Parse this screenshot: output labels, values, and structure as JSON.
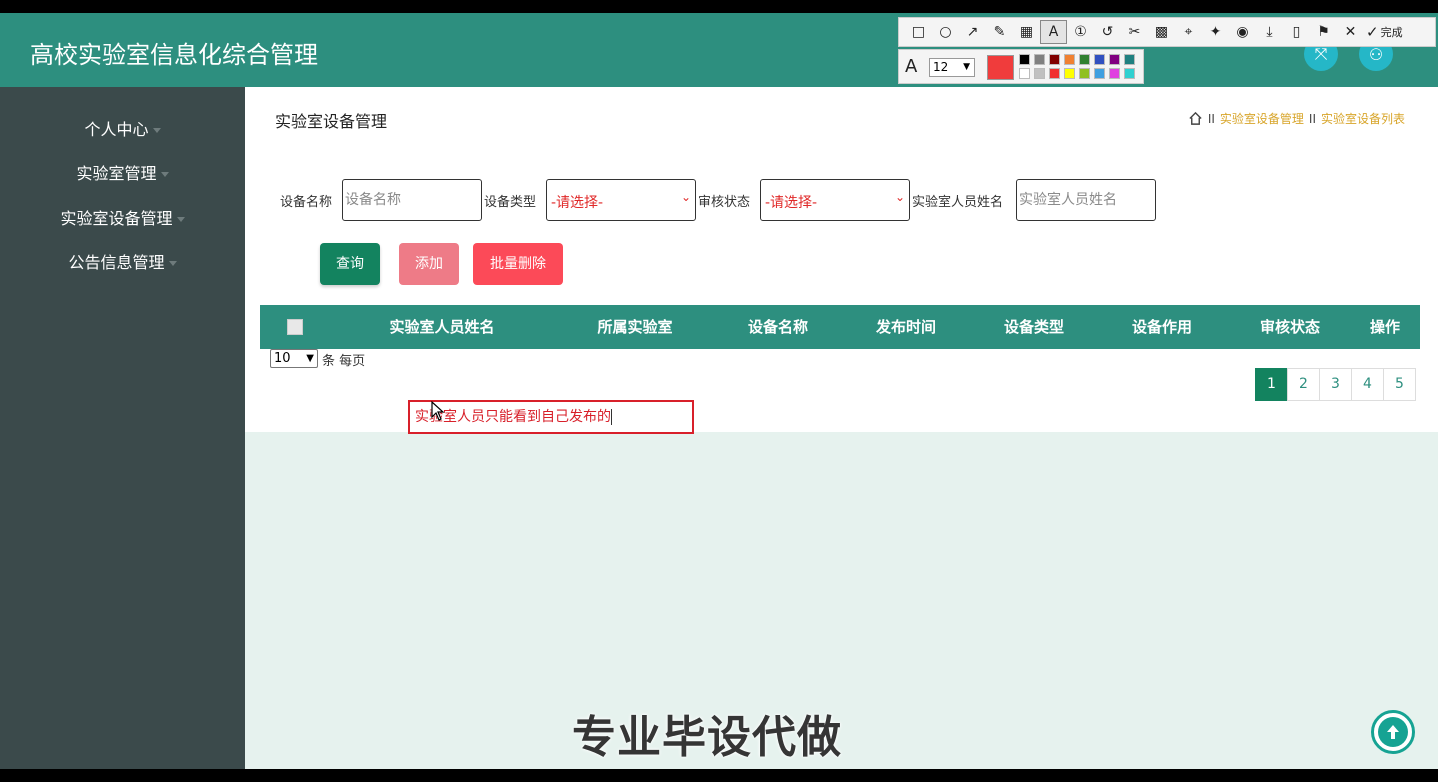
{
  "app": {
    "title": "高校实验室信息化综合管理"
  },
  "sidebar": {
    "items": [
      {
        "label": "个人中心"
      },
      {
        "label": "实验室管理"
      },
      {
        "label": "实验室设备管理"
      },
      {
        "label": "公告信息管理"
      }
    ]
  },
  "main": {
    "page_title": "实验室设备管理",
    "breadcrumb": [
      "实验室设备管理",
      "实验室设备列表"
    ],
    "breadcrumb_sep": "II",
    "filters": {
      "name_label": "设备名称",
      "name_placeholder": "设备名称",
      "type_label": "设备类型",
      "type_value": "-请选择-",
      "status_label": "审核状态",
      "status_value": "-请选择-",
      "staff_label": "实验室人员姓名",
      "staff_placeholder": "实验室人员姓名"
    },
    "buttons": {
      "query": "查询",
      "add": "添加",
      "batch_delete": "批量删除"
    },
    "table": {
      "headers": [
        "实验室人员姓名",
        "所属实验室",
        "设备名称",
        "发布时间",
        "设备类型",
        "设备作用",
        "审核状态",
        "操作"
      ]
    },
    "page_size": "10",
    "per_page_text": "条 每页",
    "pages": [
      "1",
      "2",
      "3",
      "4",
      "5"
    ],
    "active_page": "1"
  },
  "annotation": {
    "text": "实验室人员只能看到自己发布的"
  },
  "snip_toolbar": {
    "done_label": "完成",
    "font_size": "12",
    "current_color": "#f03c3c",
    "palette": [
      "#000000",
      "#808080",
      "#800000",
      "#f08030",
      "#308030",
      "#3050c0",
      "#800080",
      "#208080",
      "#ffffff",
      "#c0c0c0",
      "#f03030",
      "#ffff00",
      "#90c020",
      "#40a0e0",
      "#e040e0",
      "#30d0d0"
    ]
  },
  "watermark": "专业毕设代做",
  "colors": {
    "header": "#2d8f7f",
    "sidebar": "#3b4a4b",
    "accent": "#13835f",
    "add": "#ee7b87",
    "delete": "#fc4a58"
  }
}
